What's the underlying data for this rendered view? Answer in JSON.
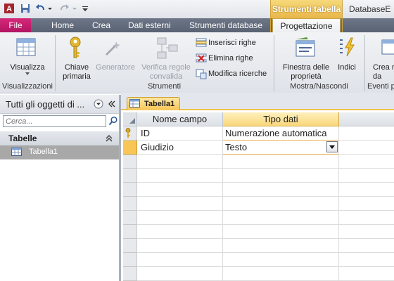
{
  "titlebar": {
    "context_tab": "Strumenti tabella",
    "db_title": "DatabaseE"
  },
  "tabs": [
    "File",
    "Home",
    "Crea",
    "Dati esterni",
    "Strumenti database",
    "Progettazione"
  ],
  "ribbon": {
    "visualizza": "Visualizza",
    "chiave": "Chiave primaria",
    "generatore": "Generatore",
    "verifica": "Verifica regole convalida",
    "inserisci": "Inserisci righe",
    "elimina": "Elimina righe",
    "modifica": "Modifica ricerche",
    "finestra": "Finestra delle proprietà",
    "indici": "Indici",
    "crea_macro": "Crea m di da",
    "groups": [
      "Visualizzazioni",
      "Strumenti",
      "Mostra/Nascondi",
      "Eventi p"
    ]
  },
  "nav": {
    "header": "Tutti gli oggetti di ...",
    "search_placeholder": "Cerca...",
    "group": "Tabelle",
    "items": [
      "Tabella1"
    ]
  },
  "document": {
    "tab": "Tabella1",
    "columns": [
      "Nome campo",
      "Tipo dati"
    ],
    "rows": [
      {
        "name": "ID",
        "type": "Numerazione automatica",
        "key": true
      },
      {
        "name": "Giudizio",
        "type": "Testo",
        "key": false
      }
    ]
  },
  "colors": {
    "file_tab": "#c8186d",
    "context": "#e8b64a",
    "selection": "#f7c657"
  }
}
